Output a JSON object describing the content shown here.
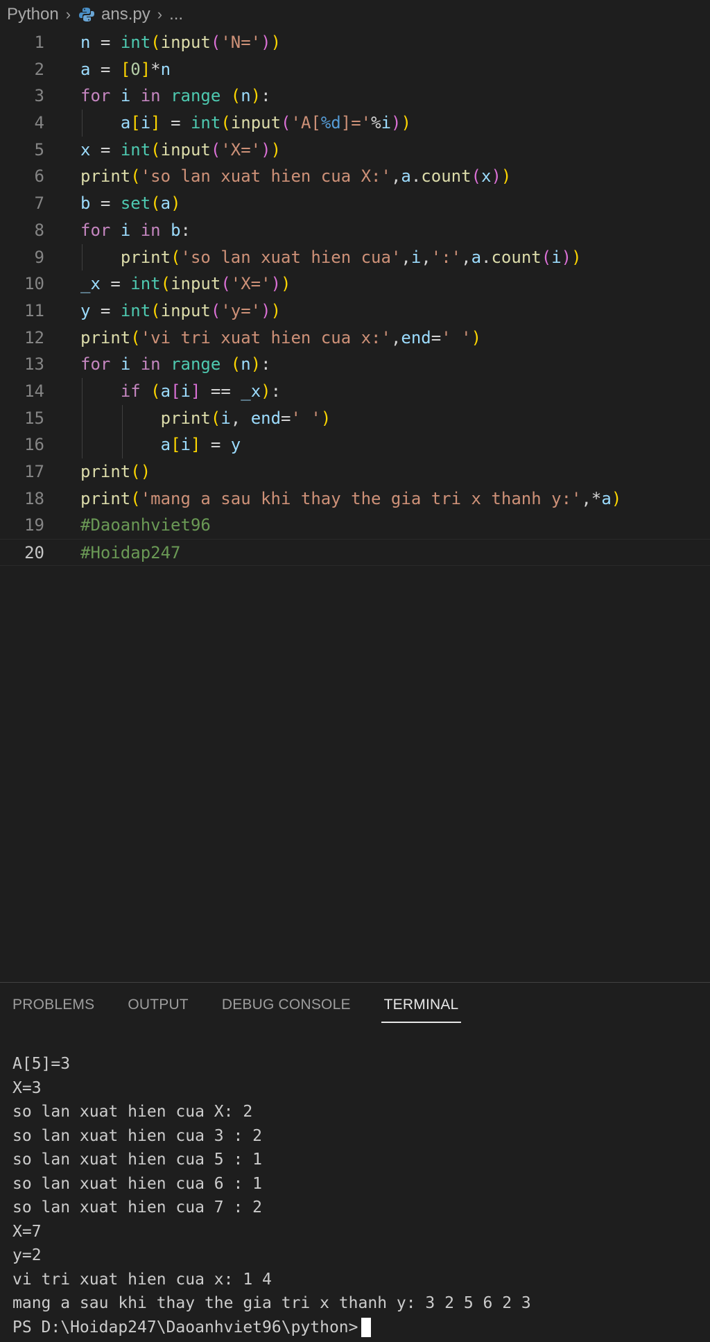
{
  "breadcrumb": {
    "root": "Python",
    "file": "ans.py",
    "more": "..."
  },
  "code": [
    "n = int(input('N='))",
    "a = [0]*n",
    "for i in range (n):",
    "    a[i] = int(input('A[%d]='%i))",
    "x = int(input('X='))",
    "print('so lan xuat hien cua X:',a.count(x))",
    "b = set(a)",
    "for i in b:",
    "    print('so lan xuat hien cua',i,':',a.count(i))",
    "_x = int(input('X='))",
    "y = int(input('y='))",
    "print('vi tri xuat hien cua x:',end=' ')",
    "for i in range (n):",
    "    if (a[i] == _x):",
    "        print(i, end=' ')",
    "        a[i] = y",
    "print()",
    "print('mang a sau khi thay the gia tri x thanh y:',*a)",
    "#Daoanhviet96",
    "#Hoidap247"
  ],
  "current_line": 20,
  "panel": {
    "tabs": [
      "PROBLEMS",
      "OUTPUT",
      "DEBUG CONSOLE",
      "TERMINAL"
    ],
    "active_tab": "TERMINAL"
  },
  "terminal": {
    "lines": [
      "A[5]=3",
      "X=3",
      "so lan xuat hien cua X: 2",
      "so lan xuat hien cua 3 : 2",
      "so lan xuat hien cua 5 : 1",
      "so lan xuat hien cua 6 : 1",
      "so lan xuat hien cua 7 : 2",
      "X=7",
      "y=2",
      "vi tri xuat hien cua x: 1 4",
      "mang a sau khi thay the gia tri x thanh y: 3 2 5 6 2 3"
    ],
    "prompt": "PS D:\\Hoidap247\\Daoanhviet96\\python>"
  },
  "colors": {
    "background": "#1e1e1e",
    "keyword": "#c586c0",
    "function": "#dcdcaa",
    "builtin": "#4ec9b0",
    "variable": "#9cdcfe",
    "string": "#ce9178",
    "comment": "#6a9955"
  },
  "icons": {
    "file_type": "python-file-icon",
    "separator": "chevron-right-icon"
  }
}
